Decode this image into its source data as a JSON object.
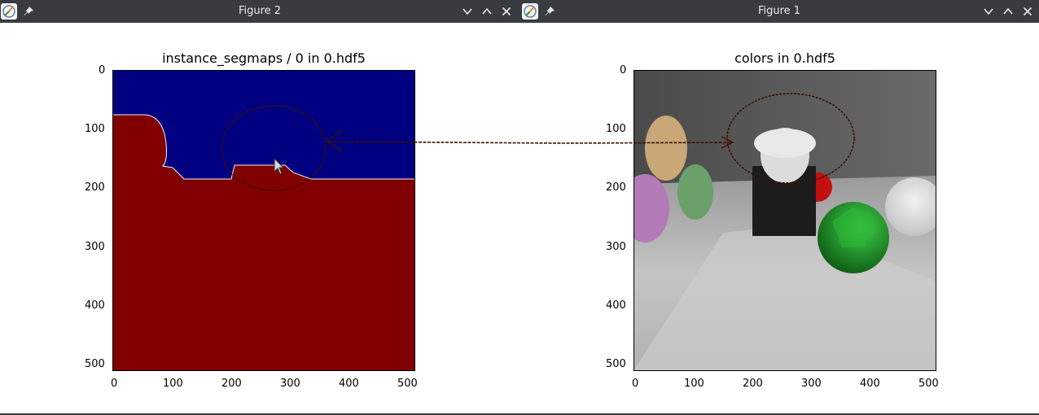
{
  "windows": {
    "left": {
      "title": "Figure 2",
      "axes_title": "instance_segmaps / 0 in 0.hdf5",
      "x_ticks": [
        "0",
        "100",
        "200",
        "300",
        "400",
        "500"
      ],
      "y_ticks": [
        "0",
        "100",
        "200",
        "300",
        "400",
        "500"
      ]
    },
    "right": {
      "title": "Figure 1",
      "axes_title": "colors in 0.hdf5",
      "x_ticks": [
        "0",
        "100",
        "200",
        "300",
        "400",
        "500"
      ],
      "y_ticks": [
        "0",
        "100",
        "200",
        "300",
        "400",
        "500"
      ]
    }
  },
  "icons": [
    "app-icon",
    "pin-icon",
    "minimize-icon",
    "maximize-icon",
    "close-icon",
    "mouse-cursor-icon"
  ],
  "colors": {
    "titlebar": "#383c41",
    "segmap_background": "#000080",
    "segmap_foreground": "#800000",
    "annotation": "#3a1200"
  }
}
